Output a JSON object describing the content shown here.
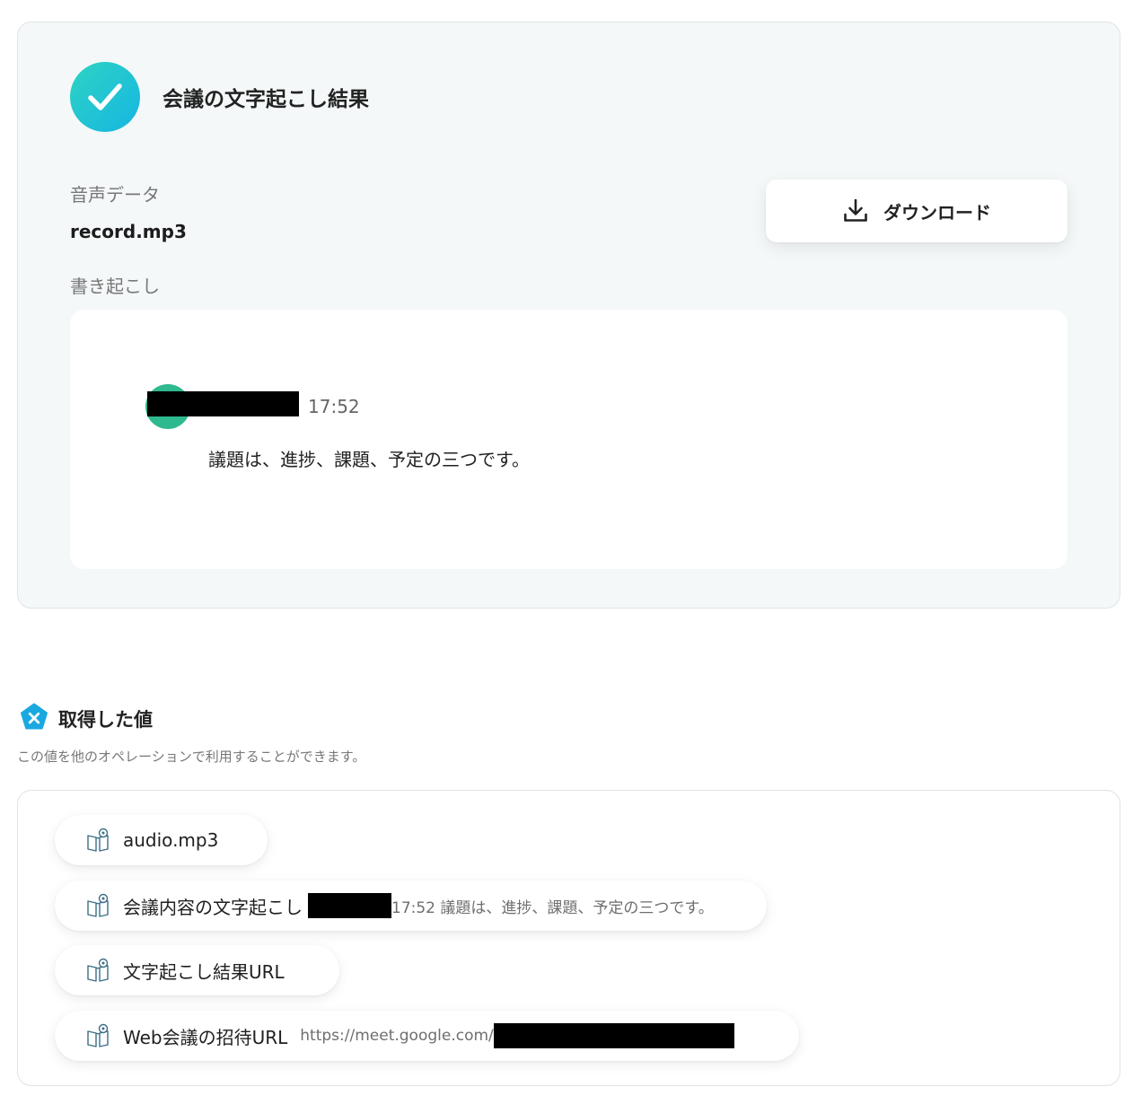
{
  "result": {
    "title": "会議の文字起こし結果",
    "audio_label": "音声データ",
    "audio_file": "record.mp3",
    "download_label": "ダウンロード",
    "transcript_label": "書き起こし",
    "transcript": {
      "time": "17:52",
      "text": "議題は、進捗、課題、予定の三つです。"
    }
  },
  "variables": {
    "title": "取得した値",
    "description": "この値を他のオペレーションで利用することができます。",
    "items": [
      {
        "name": "audio.mp3",
        "value": ""
      },
      {
        "name": "会議内容の文字起こし",
        "value": "17:52 議題は、進捗、課題、予定の三つです。"
      },
      {
        "name": "文字起こし結果URL",
        "value": ""
      },
      {
        "name": "Web会議の招待URL",
        "value": "https://meet.google.com/"
      }
    ]
  },
  "colors": {
    "accent_gradient_start": "#2ed3c2",
    "accent_gradient_end": "#16b6e2",
    "avatar": "#2fb98f",
    "variable_icon": "#1aa8e0"
  },
  "icons": {
    "check": "check-icon",
    "download": "download-icon",
    "variable": "variable-icon",
    "book": "book-icon"
  }
}
